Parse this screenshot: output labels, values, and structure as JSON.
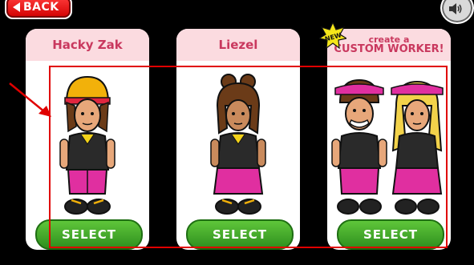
{
  "nav": {
    "back_label": "BACK",
    "back_icon": "back-arrow-icon",
    "sound_icon": "speaker-icon"
  },
  "cards": [
    {
      "title": "Hacky Zak",
      "select_label": "SELECT"
    },
    {
      "title": "Liezel",
      "select_label": "SELECT"
    },
    {
      "title_line1": "create a",
      "title_line2": "CUSTOM WORKER!",
      "badge": "NEW",
      "select_label": "SELECT"
    }
  ],
  "colors": {
    "card_header": "#fbdbe0",
    "title_text": "#c9385e",
    "select_green": "#3aa52a",
    "highlight": "#e00000"
  }
}
